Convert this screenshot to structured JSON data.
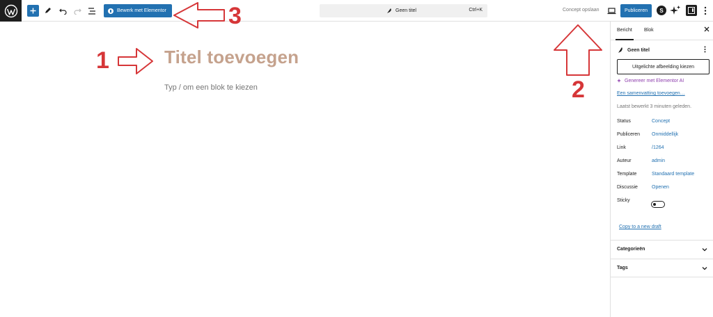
{
  "toolbar": {
    "elementor_label": "Bewerk met Elementor",
    "command_title": "Geen titel",
    "command_shortcut": "Ctrl+K",
    "save_draft_label": "Concept opslaan",
    "publish_label": "Publiceren"
  },
  "editor": {
    "title_placeholder": "Titel toevoegen",
    "block_placeholder": "Typ / om een blok te kiezen"
  },
  "annotations": [
    "1",
    "2",
    "3"
  ],
  "colors": {
    "accent": "#2271b1",
    "annotation": "#d63638",
    "title": "#c5a28d",
    "ai": "#8d3dac"
  },
  "sidebar": {
    "tabs": [
      "Bericht",
      "Blok"
    ],
    "post_title": "Geen titel",
    "featured_image_label": "Uitgelichte afbeelding kiezen",
    "generate_ai_label": "Genereer met Elementor AI",
    "summary_link": "Een samenvatting toevoegen…",
    "last_edited": "Laatst bewerkt 3 minuten geleden.",
    "meta": [
      {
        "label": "Status",
        "value": "Concept"
      },
      {
        "label": "Publiceren",
        "value": "Onmiddellijk"
      },
      {
        "label": "Link",
        "value": "/1264"
      },
      {
        "label": "Auteur",
        "value": "admin"
      },
      {
        "label": "Template",
        "value": "Standaard template"
      },
      {
        "label": "Discussie",
        "value": "Openen"
      }
    ],
    "sticky_label": "Sticky",
    "copy_link": "Copy to a new draft",
    "panels": [
      "Categorieën",
      "Tags"
    ]
  }
}
